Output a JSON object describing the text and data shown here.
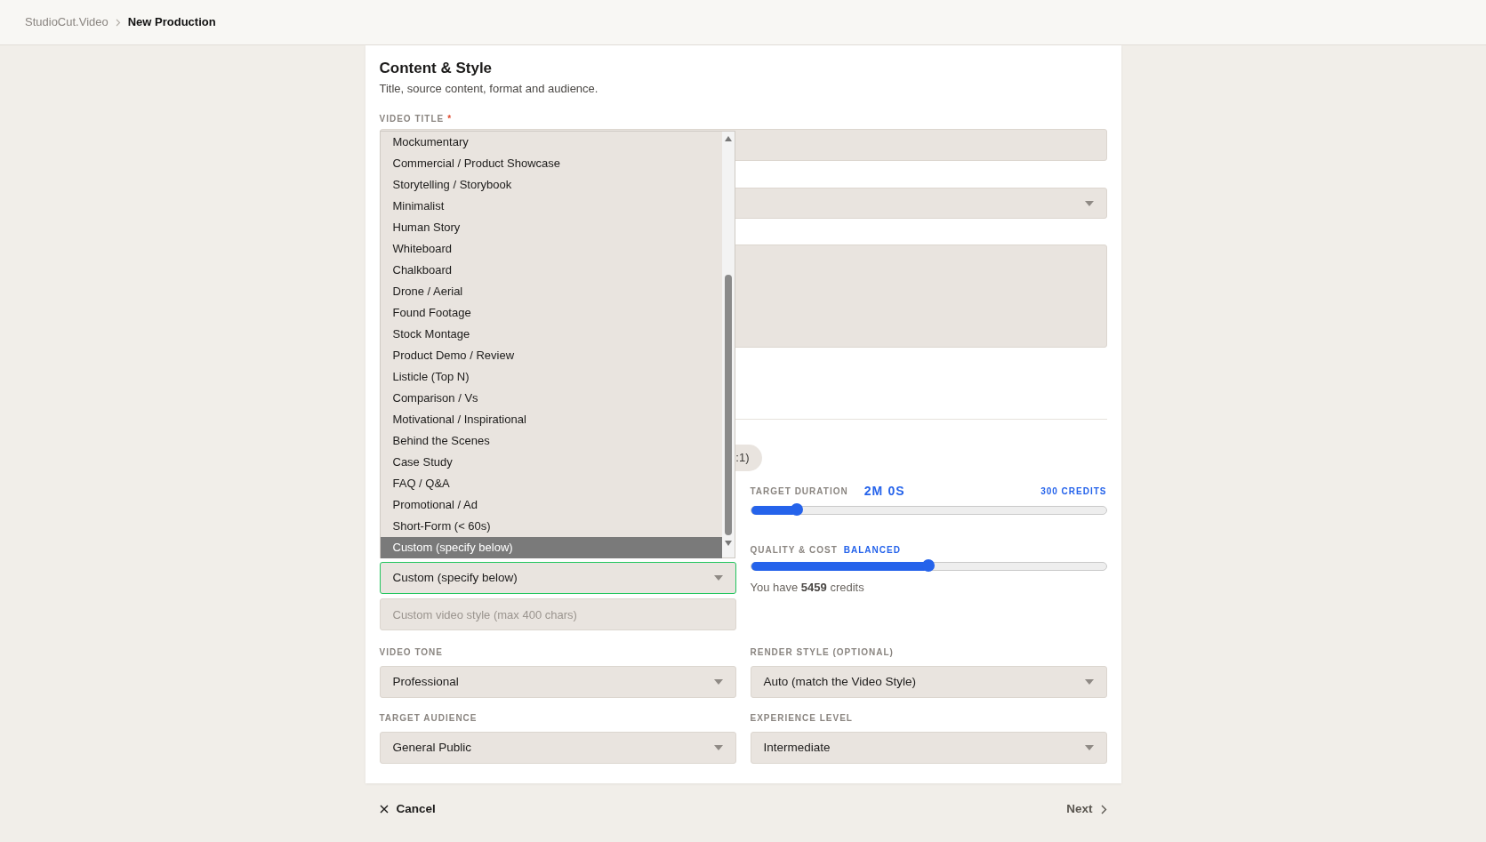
{
  "breadcrumb": [
    {
      "label": "StudioCut.Video",
      "current": false
    },
    {
      "label": "New Production",
      "current": true
    }
  ],
  "section": {
    "title": "Content & Style",
    "subtitle": "Title, source content, format and audience."
  },
  "video_title": {
    "label": "VIDEO TITLE",
    "required_mark": "*"
  },
  "aspect_chip_partial": ":1)",
  "style_dropdown": {
    "value": "Custom (specify below)",
    "focused": true,
    "options": [
      {
        "label": "Mockumentary",
        "selected": false
      },
      {
        "label": "Commercial / Product Showcase",
        "selected": false
      },
      {
        "label": "Storytelling / Storybook",
        "selected": false
      },
      {
        "label": "Minimalist",
        "selected": false
      },
      {
        "label": "Human Story",
        "selected": false
      },
      {
        "label": "Whiteboard",
        "selected": false
      },
      {
        "label": "Chalkboard",
        "selected": false
      },
      {
        "label": "Drone / Aerial",
        "selected": false
      },
      {
        "label": "Found Footage",
        "selected": false
      },
      {
        "label": "Stock Montage",
        "selected": false
      },
      {
        "label": "Product Demo / Review",
        "selected": false
      },
      {
        "label": "Listicle (Top N)",
        "selected": false
      },
      {
        "label": "Comparison / Vs",
        "selected": false
      },
      {
        "label": "Motivational / Inspirational",
        "selected": false
      },
      {
        "label": "Behind the Scenes",
        "selected": false
      },
      {
        "label": "Case Study",
        "selected": false
      },
      {
        "label": "FAQ / Q&A",
        "selected": false
      },
      {
        "label": "Promotional / Ad",
        "selected": false
      },
      {
        "label": "Short-Form (< 60s)",
        "selected": false
      },
      {
        "label": "Custom (specify below)",
        "selected": true
      }
    ]
  },
  "custom_style": {
    "placeholder": "Custom video style (max 400 chars)"
  },
  "duration": {
    "label": "TARGET DURATION",
    "value": "2M 0S",
    "cost": "300 CREDITS",
    "level": 0.13
  },
  "quality": {
    "label": "QUALITY & COST",
    "value": "BALANCED",
    "level": 0.5
  },
  "credits_note": "You have **5459** credits",
  "selects": [
    {
      "label": "VIDEO TONE",
      "value": "Professional"
    },
    {
      "label": "RENDER STYLE (OPTIONAL)",
      "value": "Auto (match the Video Style)"
    },
    {
      "label": "TARGET AUDIENCE",
      "value": "General Public"
    },
    {
      "label": "EXPERIENCE LEVEL",
      "value": "Intermediate"
    }
  ],
  "footer": {
    "cancel": "Cancel",
    "next": "Next"
  }
}
